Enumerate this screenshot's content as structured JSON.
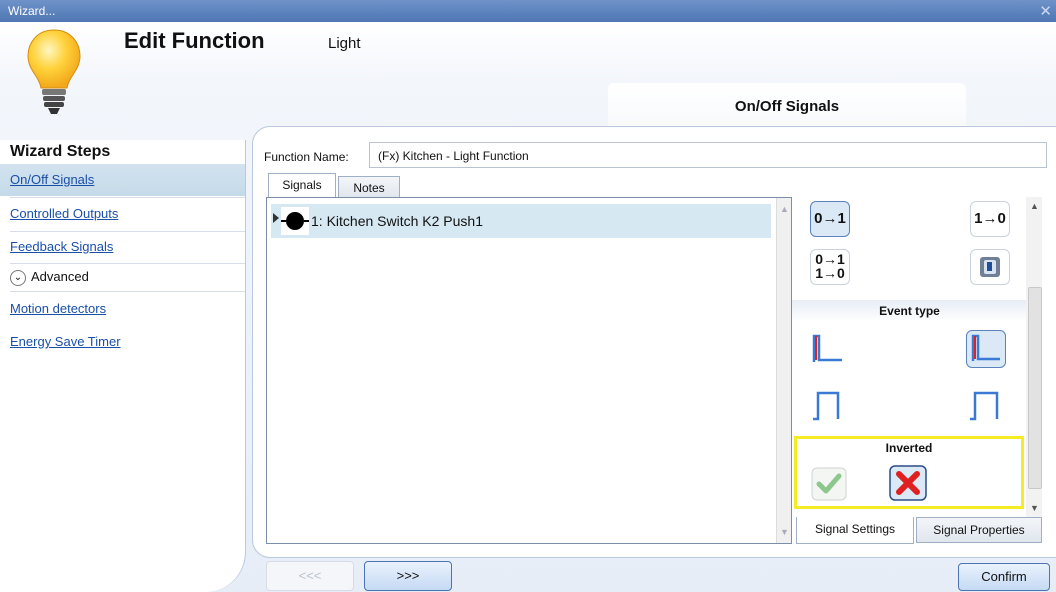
{
  "window": {
    "title": "Wizard...",
    "close_glyph": "✕"
  },
  "header": {
    "title": "Edit Function",
    "subtitle": "Light",
    "step_tab": "On/Off Signals",
    "icon": "light-bulb-icon"
  },
  "sidebar": {
    "title": "Wizard Steps",
    "items": [
      {
        "label": "On/Off Signals",
        "active": true
      },
      {
        "label": "Controlled Outputs"
      },
      {
        "label": "Feedback Signals"
      }
    ],
    "advanced_label": "Advanced",
    "advanced_items": [
      {
        "label": "Motion detectors"
      },
      {
        "label": "Energy Save Timer"
      }
    ]
  },
  "function": {
    "name_label": "Function Name:",
    "name_value": "(Fx) Kitchen - Light Function"
  },
  "tabs": [
    {
      "label": "Signals",
      "active": true
    },
    {
      "label": "Notes"
    }
  ],
  "signals": [
    {
      "label": "1: Kitchen Switch K2 Push1",
      "selected": true
    }
  ],
  "settings": {
    "transitions": [
      "0→1",
      "1→0",
      "0→1",
      "1→0"
    ],
    "event_type_label": "Event type",
    "inverted_label": "Inverted",
    "bottom_tabs": [
      {
        "label": "Signal Settings",
        "active": true
      },
      {
        "label": "Signal Properties"
      }
    ]
  },
  "buttons": {
    "back": "<<<",
    "next": ">>>",
    "confirm": "Confirm"
  },
  "colors": {
    "highlight": "#f4ec25",
    "accent": "#4f76b4",
    "link": "#1a4fa8"
  }
}
